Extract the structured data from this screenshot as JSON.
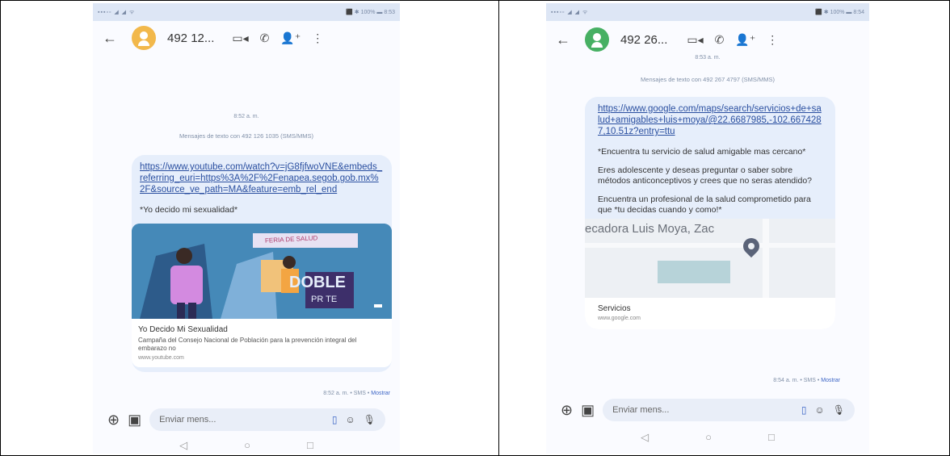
{
  "left": {
    "status_left": "▪▪▪▫▫ ◢ ◢ ᯤ",
    "status_right": "⬛ ✱ 100% ▬ 8:53",
    "contact": "492 12...",
    "time": "8:52 a. m.",
    "info": "Mensajes de texto con 492 126 1035 (SMS/MMS)",
    "link": "https://www.youtube.com/watch?v=jG8fjfwoVNE&embeds_referring_euri=https%3A%2F%2Fenapea.segob.gob.mx%2F&source_ve_path=MA&feature=emb_rel_end",
    "message": "*Yo decido mi sexualidad*",
    "card_title": "Yo Decido Mi Sexualidad",
    "card_desc": "Campaña del Consejo Nacional de Población para la prevención integral del embarazo no",
    "card_domain": "www.youtube.com",
    "thumb_sign": "FERIA DE SALUD",
    "thumb_big": "DOBLE",
    "thumb_small": "PR TE",
    "footer_time": "8:52 a. m. • SMS • ",
    "footer_action": "Mostrar",
    "composer_placeholder": "Enviar mens..."
  },
  "right": {
    "status_left": "▪▪▪▫▫ ◢ ◢ ᯤ",
    "status_right": "⬛ ✱ 100% ▬ 8:54",
    "contact": "492 26...",
    "time": "8:53 a. m.",
    "info": "Mensajes de texto con 492 267 4797 (SMS/MMS)",
    "link": "https://www.google.com/maps/search/servicios+de+salud+amigables+luis+moya/@22.6687985,-102.6674287,10.51z?entry=ttu",
    "msg1": "*Encuentra tu servicio de salud amigable mas cercano*",
    "msg2": "Eres adolescente y deseas preguntar o saber sobre métodos anticonceptivos y crees que no seras atendido?",
    "msg3": "Encuentra un profesional de la salud comprometido para que *tu decidas cuando y como!*",
    "map_label": "ecadora Luis Moya, Zac",
    "card_title": "Servicios",
    "card_domain": "www.google.com",
    "footer_time": "8:54 a. m. • SMS • ",
    "footer_action": "Mostrar",
    "composer_placeholder": "Enviar mens..."
  },
  "icons": {
    "back": "←",
    "video": "▭◂",
    "phone": "✆",
    "person_add": "👤⁺",
    "more": "⋮",
    "add": "⊕",
    "gallery": "▣",
    "sim": "▯",
    "emoji": "☺",
    "mic": "🎙",
    "nav_back": "◁",
    "nav_home": "○",
    "nav_recent": "□"
  },
  "colors": {
    "avatar_left": "#f2b84b",
    "avatar_right": "#47b063",
    "accent": "#3b64c5"
  }
}
